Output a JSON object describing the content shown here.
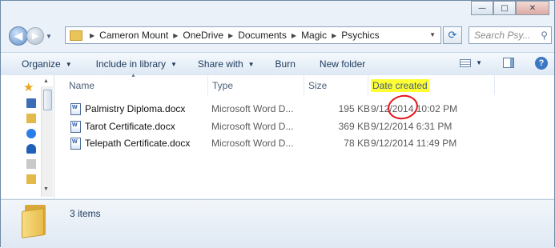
{
  "window": {
    "caption_buttons": {
      "minimize": "—",
      "maximize": "□",
      "close": "✕"
    }
  },
  "address_bar": {
    "breadcrumbs": [
      "Cameron Mount",
      "OneDrive",
      "Documents",
      "Magic",
      "Psychics"
    ]
  },
  "search": {
    "placeholder": "Search Psy..."
  },
  "toolbar": {
    "organize": "Organize",
    "include_in_library": "Include in library",
    "share_with": "Share with",
    "burn": "Burn",
    "new_folder": "New folder"
  },
  "columns": {
    "name": "Name",
    "type": "Type",
    "size": "Size",
    "date_created": "Date created"
  },
  "files": [
    {
      "name": "Palmistry Diploma.docx",
      "type": "Microsoft Word D...",
      "size": "195 KB",
      "date_created": "9/12/2014 10:02 PM"
    },
    {
      "name": "Tarot Certificate.docx",
      "type": "Microsoft Word D...",
      "size": "369 KB",
      "date_created": "9/12/2014 6:31 PM"
    },
    {
      "name": "Telepath Certificate.docx",
      "type": "Microsoft Word D...",
      "size": "78 KB",
      "date_created": "9/12/2014 11:49 PM"
    }
  ],
  "details": {
    "item_count": "3 items"
  },
  "colors": {
    "highlight": "#ffff33",
    "annotation_circle": "#e2141c"
  }
}
